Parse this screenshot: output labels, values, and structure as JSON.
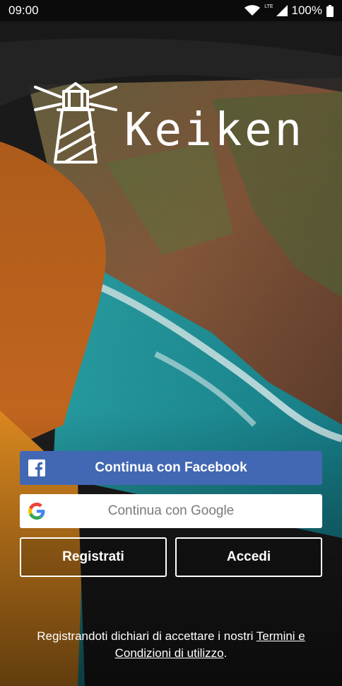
{
  "status_bar": {
    "time": "09:00",
    "network": "LTE",
    "battery": "100%",
    "icons": [
      "wifi-icon",
      "signal-icon",
      "battery-icon"
    ]
  },
  "brand": {
    "name": "Keiken",
    "logo_icon": "lighthouse-icon"
  },
  "buttons": {
    "facebook_label": "Continua con Facebook",
    "google_label": "Continua con Google",
    "register_label": "Registrati",
    "login_label": "Accedi"
  },
  "terms": {
    "prefix": "Registrandoti dichiari di accettare i nostri ",
    "link": "Termini e Condizioni di utilizzo",
    "suffix": "."
  },
  "colors": {
    "facebook": "#4268b3",
    "google_bg": "#ffffff",
    "text_light": "#ffffff",
    "google_text": "#7a7a7a"
  }
}
